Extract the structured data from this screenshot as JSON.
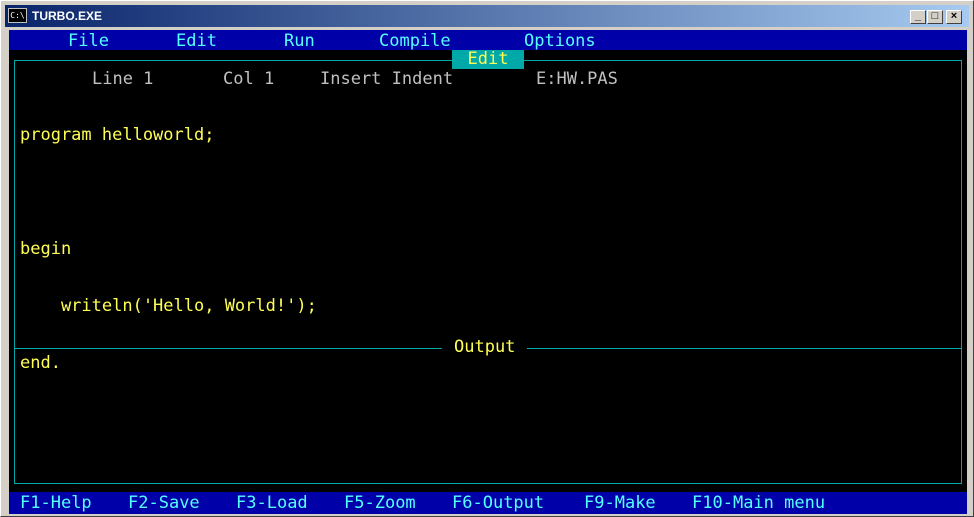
{
  "window": {
    "icon_text": "C:\\",
    "title": "TURBO.EXE",
    "minimize_glyph": "_",
    "maximize_glyph": "□",
    "close_glyph": "×"
  },
  "menu": {
    "file": "File",
    "edit": "Edit",
    "run": "Run",
    "compile": "Compile",
    "options": "Options"
  },
  "editor": {
    "tab_label": "Edit",
    "line": "Line 1",
    "col": "Col 1",
    "mode": "Insert Indent",
    "file": "E:HW.PAS",
    "code_lines": [
      "program helloworld;",
      "",
      "begin",
      "    writeln('Hello, World!');",
      "end."
    ]
  },
  "output": {
    "label": "Output"
  },
  "function_keys": [
    {
      "key": "F1",
      "desc": "-Help"
    },
    {
      "key": "F2",
      "desc": "-Save"
    },
    {
      "key": "F3",
      "desc": "-Load"
    },
    {
      "key": "F5",
      "desc": "-Zoom"
    },
    {
      "key": "F6",
      "desc": "-Output"
    },
    {
      "key": "F9",
      "desc": "-Make"
    },
    {
      "key": "F10",
      "desc": "-Main menu"
    }
  ],
  "colors": {
    "menu_bg": "#0000a8",
    "menu_text": "#55ffff",
    "code_text": "#ffff55",
    "border": "#00a8a8",
    "status_text": "#c0c0c0"
  }
}
